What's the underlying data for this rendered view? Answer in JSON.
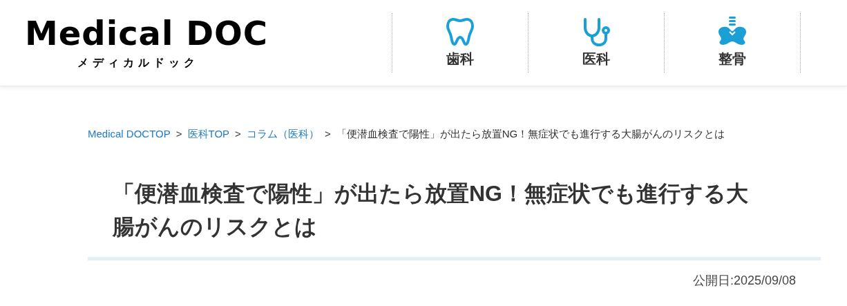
{
  "header": {
    "logo": {
      "text": "Medical DOC",
      "subtitle": "メディカルドック"
    },
    "nav": [
      {
        "label": "歯科",
        "kind": "tooth"
      },
      {
        "label": "医科",
        "kind": "stethoscope"
      },
      {
        "label": "整骨",
        "kind": "pelvis"
      }
    ]
  },
  "breadcrumb": [
    {
      "label": "Medical DOCTOP",
      "link": true
    },
    {
      "label": "医科TOP",
      "link": true
    },
    {
      "label": "コラム（医科）",
      "link": true
    },
    {
      "label": "「便潜血検査で陽性」が出たら放置NG！無症状でも進行する大腸がんのリスクとは",
      "link": false
    }
  ],
  "breadcrumb_separator": ">",
  "article": {
    "title": "「便潜血検査で陽性」が出たら放置NG！無症状でも進行する大腸がんのリスクとは",
    "published": "公開日:2025/09/08"
  }
}
